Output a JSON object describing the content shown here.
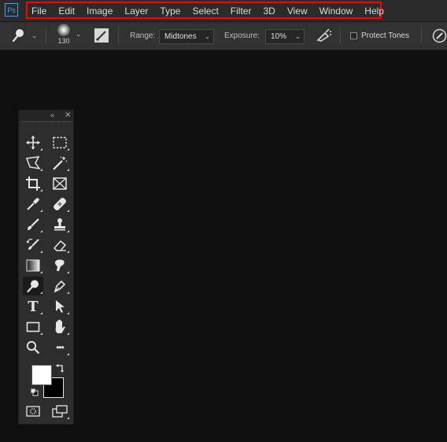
{
  "app": {
    "logo_text": "Ps",
    "accent": "#31a8ff",
    "highlight_color": "#ff0000"
  },
  "menubar": {
    "items": [
      "File",
      "Edit",
      "Image",
      "Layer",
      "Type",
      "Select",
      "Filter",
      "3D",
      "View",
      "Window",
      "Help"
    ]
  },
  "options": {
    "brush_size": "130",
    "range_label": "Range:",
    "range_value": "Midtones",
    "exposure_label": "Exposure:",
    "exposure_value": "10%",
    "protect_tones_label": "Protect Tones",
    "protect_tones_checked": false
  },
  "toolbox": {
    "tools": [
      "move-tool",
      "marquee-tool",
      "lasso-tool",
      "magic-wand-tool",
      "crop-tool",
      "frame-tool",
      "eyedropper-tool",
      "healing-brush-tool",
      "brush-tool",
      "clone-stamp-tool",
      "history-brush-tool",
      "eraser-tool",
      "gradient-tool",
      "smudge-tool",
      "dodge-tool",
      "pen-tool",
      "type-tool",
      "path-selection-tool",
      "rectangle-tool",
      "hand-tool",
      "zoom-tool",
      "edit-toolbar-tool"
    ],
    "active_tool": "dodge-tool",
    "type_glyph": "T",
    "more_glyph": "•••",
    "foreground_color": "#ffffff",
    "background_color": "#000000"
  }
}
